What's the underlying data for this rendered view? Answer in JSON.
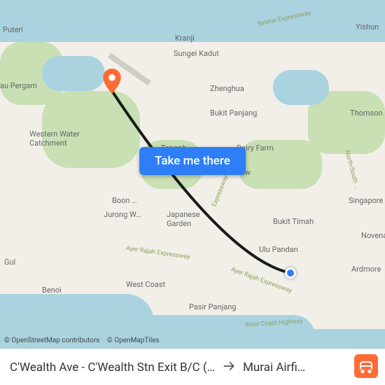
{
  "cta": {
    "label": "Take me there"
  },
  "attribution": {
    "osm": "© OpenStreetMap contributors",
    "tiles": "© OpenMapTiles"
  },
  "route": {
    "from": "C'Wealth Ave - C'Wealth Stn Exit B/C (…",
    "to": "Murai Airfi…"
  },
  "places": {
    "puteri": "Puteri",
    "pergam": "au Pergam",
    "kranji": "Kranji",
    "sungei_kadut": "Sungei Kadut",
    "yishun": "Yishun",
    "zhenghua": "Zhenghua",
    "bukit_panjang": "Bukit Panjang",
    "thomson": "Thomson",
    "western_water": "Western Water\nCatchment",
    "tengah": "Tengah",
    "dairy_farm": "Dairy Farm",
    "hillview": "Hillview",
    "boon_lay": "Boon …",
    "jurong_west": "Jurong W…",
    "japanese_garden": "Japanese\nGarden",
    "bukit_timah": "Bukit Timah",
    "singapore": "Singapore …",
    "ulu_pandan": "Ulu Pandan",
    "novena": "Novena",
    "ardmore": "Ardmore",
    "gul": "Gul",
    "benoi": "Benoi",
    "pasir_panjang": "Pasir Panjang",
    "west_coast": "West Coast"
  },
  "highways": {
    "seletar": "Seletar Expressway",
    "north_south": "North-South …",
    "expressway": "Expressway",
    "ayer_rajah1": "Ayer Rajah Expressway",
    "ayer_rajah2": "Ayer Rajah Expressway",
    "west_coast_hwy": "West Coast Highway"
  },
  "logo_alt": "moovit"
}
